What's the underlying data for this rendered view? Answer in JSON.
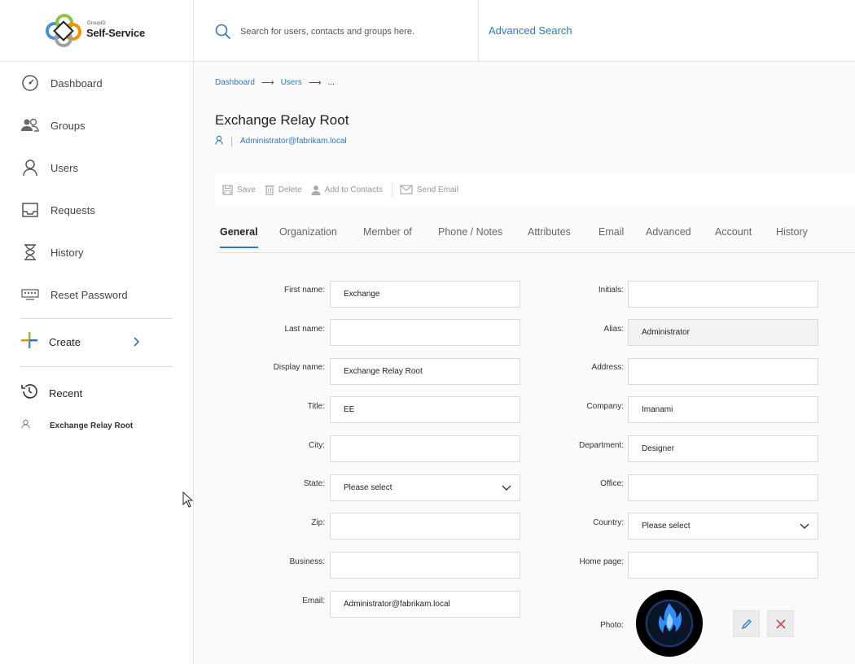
{
  "header": {
    "brand_small": "GroupID",
    "brand_name": "Self-Service",
    "search_placeholder": "Search for users, contacts and groups here.",
    "advanced_search": "Advanced Search"
  },
  "sidebar": {
    "items": [
      {
        "label": "Dashboard",
        "icon": "dashboard-gauge-icon"
      },
      {
        "label": "Groups",
        "icon": "groups-icon"
      },
      {
        "label": "Users",
        "icon": "user-icon"
      },
      {
        "label": "Requests",
        "icon": "inbox-icon"
      },
      {
        "label": "History",
        "icon": "hourglass-icon"
      },
      {
        "label": "Reset Password",
        "icon": "keyboard-password-icon"
      }
    ],
    "create_label": "Create",
    "recent_title": "Recent",
    "recent_items": [
      {
        "label": "Exchange Relay Root",
        "icon": "user-icon"
      }
    ]
  },
  "breadcrumb": {
    "items": [
      "Dashboard",
      "Users"
    ],
    "ellipsis": "..."
  },
  "page": {
    "title": "Exchange Relay Root",
    "subtitle_email": "Administrator@fabrikam.local"
  },
  "toolbar": {
    "save": "Save",
    "delete": "Delete",
    "add_to_contacts": "Add to Contacts",
    "send_email": "Send Email"
  },
  "tabs": [
    "General",
    "Organization",
    "Member of",
    "Phone / Notes",
    "Attributes",
    "Email",
    "Advanced",
    "Account",
    "History"
  ],
  "active_tab": "General",
  "form": {
    "left": [
      {
        "label": "First name:",
        "value": "Exchange",
        "type": "text"
      },
      {
        "label": "Last name:",
        "value": "",
        "type": "text"
      },
      {
        "label": "Display name:",
        "value": "Exchange Relay Root",
        "type": "text"
      },
      {
        "label": "Title:",
        "value": "EE",
        "type": "text"
      },
      {
        "label": "City:",
        "value": "",
        "type": "text"
      },
      {
        "label": "State:",
        "value": "Please select",
        "type": "select"
      },
      {
        "label": "Zip:",
        "value": "",
        "type": "text"
      },
      {
        "label": "Business:",
        "value": "",
        "type": "text"
      },
      {
        "label": "Email:",
        "value": "Administrator@fabrikam.local",
        "type": "text"
      }
    ],
    "right": [
      {
        "label": "Initials:",
        "value": "",
        "type": "text"
      },
      {
        "label": "Alias:",
        "value": "Administrator",
        "type": "text",
        "disabled": true
      },
      {
        "label": "Address:",
        "value": "",
        "type": "text"
      },
      {
        "label": "Company:",
        "value": "Imanami",
        "type": "text"
      },
      {
        "label": "Department:",
        "value": "Designer",
        "type": "text"
      },
      {
        "label": "Office:",
        "value": "",
        "type": "text"
      },
      {
        "label": "Country:",
        "value": "Please select",
        "type": "select"
      },
      {
        "label": "Home page:",
        "value": "",
        "type": "text"
      }
    ],
    "photo_label": "Photo:"
  },
  "colors": {
    "accent": "#2a7ac7",
    "remove": "#d64545"
  }
}
